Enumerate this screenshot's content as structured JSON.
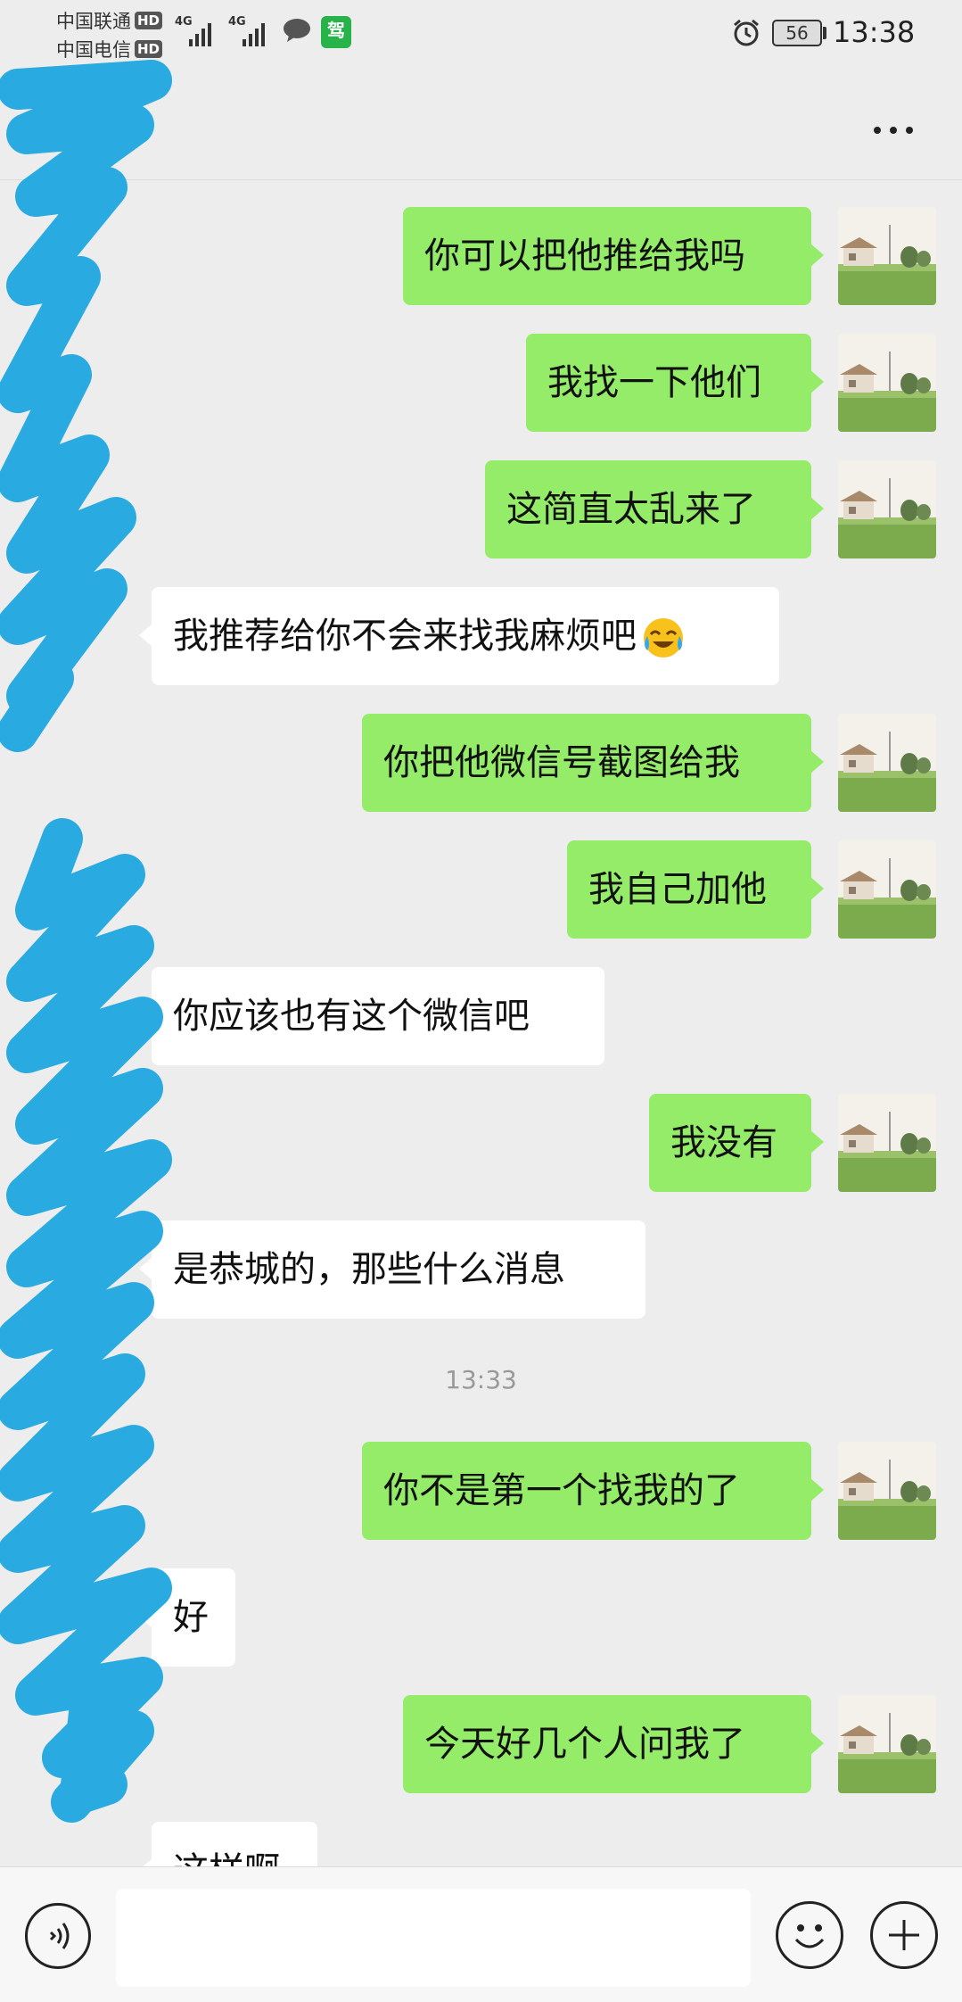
{
  "status_bar": {
    "carrier_1": "中国联通",
    "carrier_2": "中国电信",
    "hd_badge": "HD",
    "network_1": "4G",
    "network_2": "4G",
    "app_badge": "驾",
    "battery_level": "56",
    "time": "13:38",
    "icons": [
      "signal-icon",
      "wechat-status-icon",
      "alarm-icon",
      "battery-icon"
    ]
  },
  "header": {
    "more_icon": "more-dots-icon"
  },
  "messages": [
    {
      "side": "sent",
      "text": "你可以把他推给我吗"
    },
    {
      "side": "sent",
      "text": "我找一下他们"
    },
    {
      "side": "sent",
      "text": "这简直太乱来了"
    },
    {
      "side": "recv",
      "text": "我推荐给你不会来找我麻烦吧",
      "emoji": "laughing-crying-emoji"
    },
    {
      "side": "sent",
      "text": "你把他微信号截图给我"
    },
    {
      "side": "sent",
      "text": "我自己加他"
    },
    {
      "side": "recv",
      "text": "你应该也有这个微信吧"
    },
    {
      "side": "sent",
      "text": "我没有"
    },
    {
      "side": "recv",
      "text": "是恭城的，那些什么消息"
    },
    {
      "side": "sent",
      "text": "你不是第一个找我的了"
    },
    {
      "side": "recv",
      "text": "好"
    },
    {
      "side": "sent",
      "text": "今天好几个人问我了"
    },
    {
      "side": "recv",
      "text": "这样啊"
    }
  ],
  "time_divider": "13:33",
  "input_bar": {
    "voice_icon": "voice-icon",
    "input_value": "",
    "emoji_icon": "smiley-icon",
    "plus_icon": "plus-icon"
  },
  "colors": {
    "background": "#ededed",
    "sent_bubble": "#95ec69",
    "recv_bubble": "#ffffff",
    "scribble": "#29abe2"
  }
}
